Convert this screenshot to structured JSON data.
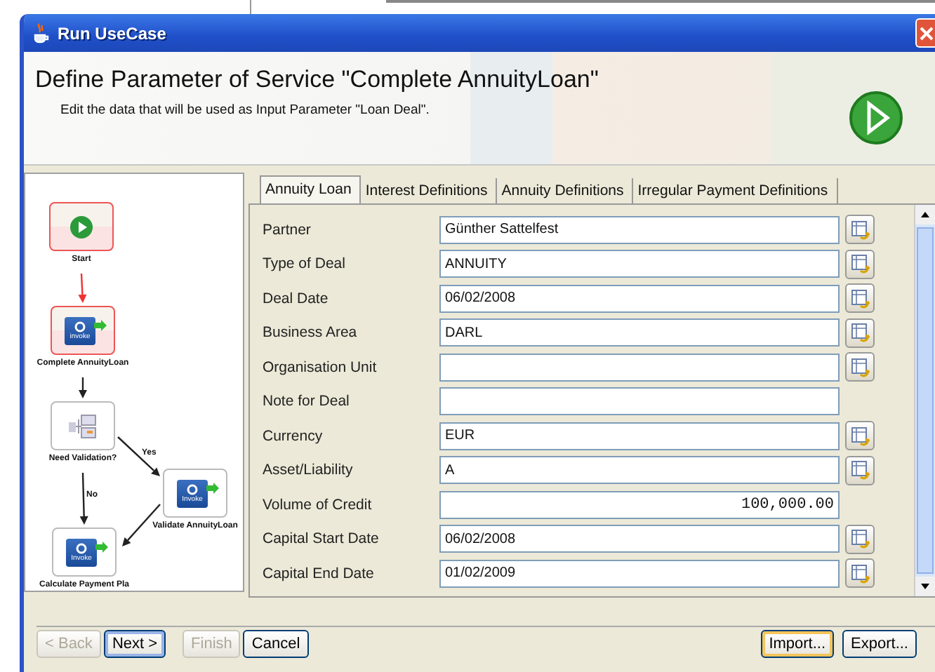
{
  "window": {
    "title": "Run UseCase"
  },
  "header": {
    "title": "Define Parameter of Service \"Complete AnnuityLoan\"",
    "subtitle": "Edit the data that will be used as Input Parameter \"Loan Deal\"."
  },
  "diagram": {
    "nodes": [
      {
        "kind": "start",
        "label": "Start",
        "highlighted": true
      },
      {
        "kind": "invoke",
        "label": "Complete AnnuityLoan",
        "badge": "invoke",
        "highlighted": true
      },
      {
        "kind": "decision",
        "label": "Need Validation?",
        "highlighted": false
      },
      {
        "kind": "invoke",
        "label": "Validate AnnuityLoan",
        "badge": "Invoke",
        "highlighted": false
      },
      {
        "kind": "invoke",
        "label": "Calculate Payment Pla",
        "badge": "Invoke",
        "highlighted": false
      }
    ],
    "edges": [
      {
        "highlighted": true
      },
      {
        "highlighted": false
      },
      {
        "label": "Yes",
        "highlighted": false
      },
      {
        "label": "No",
        "highlighted": false
      },
      {
        "highlighted": false
      }
    ]
  },
  "tabs": [
    {
      "label": "Annuity Loan",
      "selected": true
    },
    {
      "label": "Interest Definitions",
      "selected": false
    },
    {
      "label": "Annuity Definitions",
      "selected": false
    },
    {
      "label": "Irregular Payment Definitions",
      "selected": false
    }
  ],
  "fields": [
    {
      "label": "Partner",
      "value": "Günther Sattelfest",
      "kind": "text",
      "lookup": true
    },
    {
      "label": "Type of Deal",
      "value": "ANNUITY",
      "kind": "text",
      "lookup": true
    },
    {
      "label": "Deal Date",
      "value": "06/02/2008",
      "kind": "text",
      "lookup": true
    },
    {
      "label": "Business Area",
      "value": "DARL",
      "kind": "text",
      "lookup": true
    },
    {
      "label": "Organisation Unit",
      "kind": "text",
      "lookup": true
    },
    {
      "label": "Note for Deal",
      "kind": "text",
      "lookup": false
    },
    {
      "label": "Currency",
      "value": "EUR",
      "kind": "text",
      "lookup": true
    },
    {
      "label": "Asset/Liability",
      "value": "A",
      "kind": "text",
      "lookup": true
    },
    {
      "label": "Volume of Credit",
      "value": "100,000.00",
      "kind": "number",
      "lookup": false
    },
    {
      "label": "Capital Start Date",
      "value": "06/02/2008",
      "kind": "text",
      "lookup": true
    },
    {
      "label": "Capital End Date",
      "value": "01/02/2009",
      "kind": "text",
      "lookup": true
    }
  ],
  "footer": {
    "left_buttons": [
      {
        "label": "< Back",
        "disabled": true,
        "default": false,
        "hot": false
      },
      {
        "label": "Next >",
        "disabled": false,
        "default": true,
        "hot": false
      },
      {
        "label": "Finish",
        "disabled": true,
        "default": false,
        "hot": false
      },
      {
        "label": "Cancel",
        "disabled": false,
        "default": false,
        "hot": false
      }
    ],
    "right_buttons": [
      {
        "label": "Import...",
        "disabled": false,
        "default": false,
        "hot": true
      },
      {
        "label": "Export...",
        "disabled": false,
        "default": false,
        "hot": false
      }
    ]
  }
}
